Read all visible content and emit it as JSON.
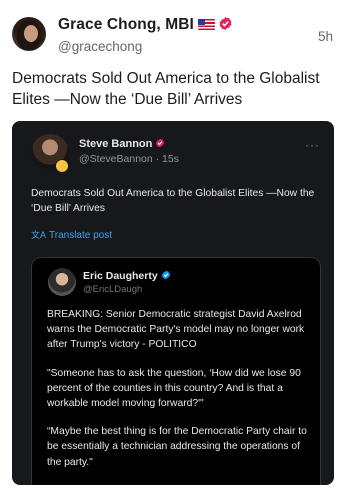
{
  "post": {
    "author_name": "Grace Chong, MBI",
    "handle": "@gracechong",
    "timestamp": "5h",
    "text": "Democrats Sold Out America to the Globalist Elites —Now the ‘Due Bill’ Arrives",
    "flag_icon": "us-flag-icon",
    "verified_color": "#e0245e"
  },
  "embedded_post": {
    "author_name": "Steve Bannon",
    "handle_time": "@SteveBannon · 15s",
    "more": "···",
    "text": "Democrats Sold Out America to the Globalist Elites —Now the ‘Due Bill’ Arrives",
    "translate_label": "Translate post",
    "verified_color": "#e0245e",
    "background": "#16181c"
  },
  "quoted_post": {
    "author_name": "Eric Daugherty",
    "handle": "@EricLDaugh",
    "verified_color": "#1d9bf0",
    "paragraphs": [
      "BREAKING: Senior Democratic strategist David Axelrod warns the Democratic Party's model may no longer work after Trump's victory - POLITICO",
      "\"Someone has to ask the question, ‘How did we lose 90 percent of the counties in this country? And is that a workable model moving forward?'\"",
      "“Maybe the best thing is for the Democratic Party chair to be essentially a technician addressing the operations of the party.\""
    ]
  }
}
